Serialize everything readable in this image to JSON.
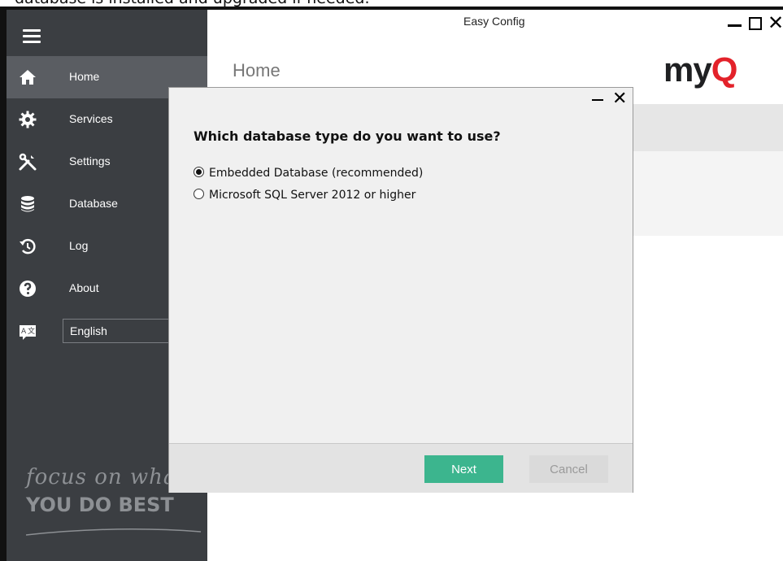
{
  "caption_top_text": "database is installed and upgraded if needed.",
  "window": {
    "title": "Easy Config"
  },
  "sidebar": {
    "items": [
      {
        "label": "Home",
        "icon": "home-icon"
      },
      {
        "label": "Services",
        "icon": "gear-icon"
      },
      {
        "label": "Settings",
        "icon": "tools-icon"
      },
      {
        "label": "Database",
        "icon": "database-icon"
      },
      {
        "label": "Log",
        "icon": "history-icon"
      },
      {
        "label": "About",
        "icon": "question-icon"
      }
    ],
    "language": "English",
    "slogan_line1": "focus on wha",
    "slogan_line2": "YOU DO BEST"
  },
  "main": {
    "page_title": "Home",
    "logo_text_main": "my",
    "logo_text_accent": "Q"
  },
  "dialog": {
    "question": "Which database type do you want to use?",
    "options": [
      {
        "label": "Embedded Database (recommended)",
        "selected": true
      },
      {
        "label": "Microsoft SQL Server 2012 or higher",
        "selected": false
      }
    ],
    "next_label": "Next",
    "cancel_label": "Cancel"
  },
  "colors": {
    "accent": "#3cb58e",
    "sidebar": "#3b3e42",
    "logo_red": "#e3222a"
  }
}
